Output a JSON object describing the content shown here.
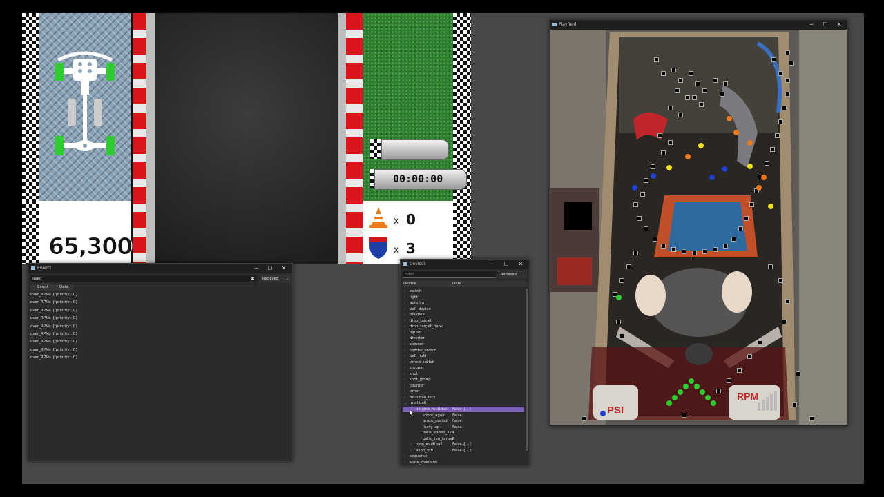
{
  "game_display": {
    "score": "65,300",
    "timer": "00:00:00",
    "cones_prefix": "x",
    "cones_count": "0",
    "shields_prefix": "x",
    "shields_count": "3",
    "colors": {
      "stripe_red": "#d8161c",
      "grass": "#2f7d2f",
      "led_green": "#2ecc2e"
    }
  },
  "events_window": {
    "title": "Events",
    "filter_value": "over",
    "filter_mode": "Recieved",
    "columns": [
      "Event",
      "Data"
    ],
    "rows": [
      {
        "event": "over_RPMs",
        "data": "{'priority': 0}"
      },
      {
        "event": "over_RPMs",
        "data": "{'priority': 0}"
      },
      {
        "event": "over_RPMs",
        "data": "{'priority': 0}"
      },
      {
        "event": "over_RPMs",
        "data": "{'priority': 0}"
      },
      {
        "event": "over_RPMs",
        "data": "{'priority': 0}"
      },
      {
        "event": "over_RPMs",
        "data": "{'priority': 0}"
      },
      {
        "event": "over_RPMs",
        "data": "{'priority': 0}"
      },
      {
        "event": "over_RPMs",
        "data": "{'priority': 0}"
      },
      {
        "event": "over_RPMs",
        "data": "{'priority': 0}"
      }
    ]
  },
  "devices_window": {
    "title": "Devices",
    "filter_placeholder": "Filter",
    "filter_mode": "Recieved",
    "columns": [
      "Device",
      "Data"
    ],
    "rows": [
      {
        "label": "switch",
        "data": "",
        "level": 0,
        "arrow": "›"
      },
      {
        "label": "light",
        "data": "",
        "level": 0,
        "arrow": "›"
      },
      {
        "label": "autofire",
        "data": "",
        "level": 0,
        "arrow": "›"
      },
      {
        "label": "ball_device",
        "data": "",
        "level": 0,
        "arrow": "›"
      },
      {
        "label": "playfield",
        "data": "",
        "level": 0,
        "arrow": "›"
      },
      {
        "label": "drop_target",
        "data": "",
        "level": 0,
        "arrow": "›"
      },
      {
        "label": "drop_target_bank",
        "data": "",
        "level": 0,
        "arrow": "›"
      },
      {
        "label": "flipper",
        "data": "",
        "level": 0,
        "arrow": "›"
      },
      {
        "label": "diverter",
        "data": "",
        "level": 0,
        "arrow": "›"
      },
      {
        "label": "spinner",
        "data": "",
        "level": 0,
        "arrow": "›"
      },
      {
        "label": "combo_switch",
        "data": "",
        "level": 0,
        "arrow": "›"
      },
      {
        "label": "ball_hold",
        "data": "",
        "level": 0,
        "arrow": "›"
      },
      {
        "label": "timed_switch",
        "data": "",
        "level": 0,
        "arrow": "›"
      },
      {
        "label": "stepper",
        "data": "",
        "level": 0,
        "arrow": "›"
      },
      {
        "label": "shot",
        "data": "",
        "level": 0,
        "arrow": "›"
      },
      {
        "label": "shot_group",
        "data": "",
        "level": 0,
        "arrow": "›"
      },
      {
        "label": "counter",
        "data": "",
        "level": 0,
        "arrow": "›"
      },
      {
        "label": "timer",
        "data": "",
        "level": 0,
        "arrow": "›"
      },
      {
        "label": "multiball_lock",
        "data": "",
        "level": 0,
        "arrow": "›"
      },
      {
        "label": "multiball",
        "data": "",
        "level": 0,
        "arrow": "⌄"
      },
      {
        "label": "pingine_multiball",
        "data": "False {...}",
        "level": 1,
        "arrow": "⌄",
        "selected": true
      },
      {
        "label": "shoot_again",
        "data": "False",
        "level": 2,
        "arrow": ""
      },
      {
        "label": "grace_period",
        "data": "False",
        "level": 2,
        "arrow": ""
      },
      {
        "label": "hurry_up",
        "data": "False",
        "level": 2,
        "arrow": ""
      },
      {
        "label": "balls_added_live",
        "data": "7",
        "level": 2,
        "arrow": ""
      },
      {
        "label": "balls_live_target",
        "data": "8",
        "level": 2,
        "arrow": ""
      },
      {
        "label": "loop_multiball",
        "data": "False {...}",
        "level": 1,
        "arrow": "›"
      },
      {
        "label": "expo_mb",
        "data": "False {...}",
        "level": 1,
        "arrow": "›"
      },
      {
        "label": "sequence",
        "data": "",
        "level": 0,
        "arrow": "›"
      },
      {
        "label": "state_machine",
        "data": "",
        "level": 0,
        "arrow": "›"
      }
    ]
  },
  "playfield_window": {
    "title": "Playfield",
    "psi_label": "PSI",
    "rpm_label": "RPM",
    "lamp_colors": {
      "yellow": "#f2e21a",
      "blue": "#1d3fd8",
      "green": "#2ecc2e",
      "orange": "#f07a1a"
    }
  },
  "window_controls": {
    "minimize": "─",
    "maximize": "☐",
    "close": "✕"
  }
}
